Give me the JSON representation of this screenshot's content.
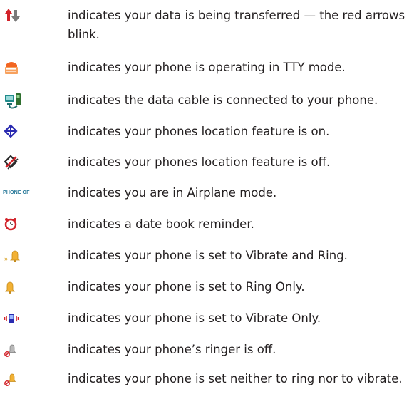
{
  "items": [
    {
      "icon": "data-transfer-arrows-icon",
      "text": "indicates your data is being transferred — the red arrows blink."
    },
    {
      "icon": "tty-mode-icon",
      "text": "indicates your phone is operating in TTY mode."
    },
    {
      "icon": "data-cable-icon",
      "text": "indicates the data cable is connected to your phone."
    },
    {
      "icon": "location-on-icon",
      "text": "indicates your phones location feature is on."
    },
    {
      "icon": "location-off-icon",
      "text": "indicates your phones location feature is off."
    },
    {
      "icon": "airplane-mode-phone-off-icon",
      "icon_text": "PHONE OFF",
      "text": "indicates you are in Airplane mode."
    },
    {
      "icon": "alarm-clock-icon",
      "text": "indicates a date book reminder."
    },
    {
      "icon": "vibrate-and-ring-icon",
      "text": "indicates your phone is set to Vibrate and Ring."
    },
    {
      "icon": "ring-only-bell-icon",
      "text": "indicates your phone is set to Ring Only."
    },
    {
      "icon": "vibrate-only-icon",
      "text": "indicates your phone is set to Vibrate Only."
    },
    {
      "icon": "ringer-off-icon",
      "text": "indicates your phone’s ringer is off."
    },
    {
      "icon": "silent-no-ring-no-vibrate-icon",
      "text": "indicates your phone is set neither to ring nor to vibrate."
    }
  ],
  "colors": {
    "text": "#231f20",
    "red": "#d2232a",
    "orange": "#f26522",
    "blue": "#2a2ab0",
    "teal": "#1f8a8a",
    "gold": "#f2b134"
  }
}
